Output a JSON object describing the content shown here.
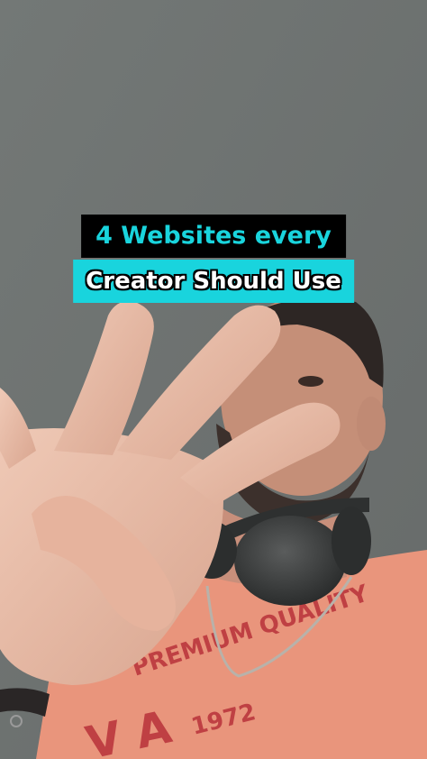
{
  "caption": {
    "line1": "4 Websites every",
    "line2": "Creator Should Use"
  },
  "shirt_text": {
    "line1": "PREMIUM QUALITY",
    "line2": "1972"
  },
  "colors": {
    "caption_line1_bg": "#000000",
    "caption_line1_text": "#19d4dd",
    "caption_line2_bg": "#19d4dd",
    "caption_line2_text": "#ffffff",
    "wall": "#6f7372",
    "shirt": "#e9957c",
    "skin": "#e8bba6"
  }
}
